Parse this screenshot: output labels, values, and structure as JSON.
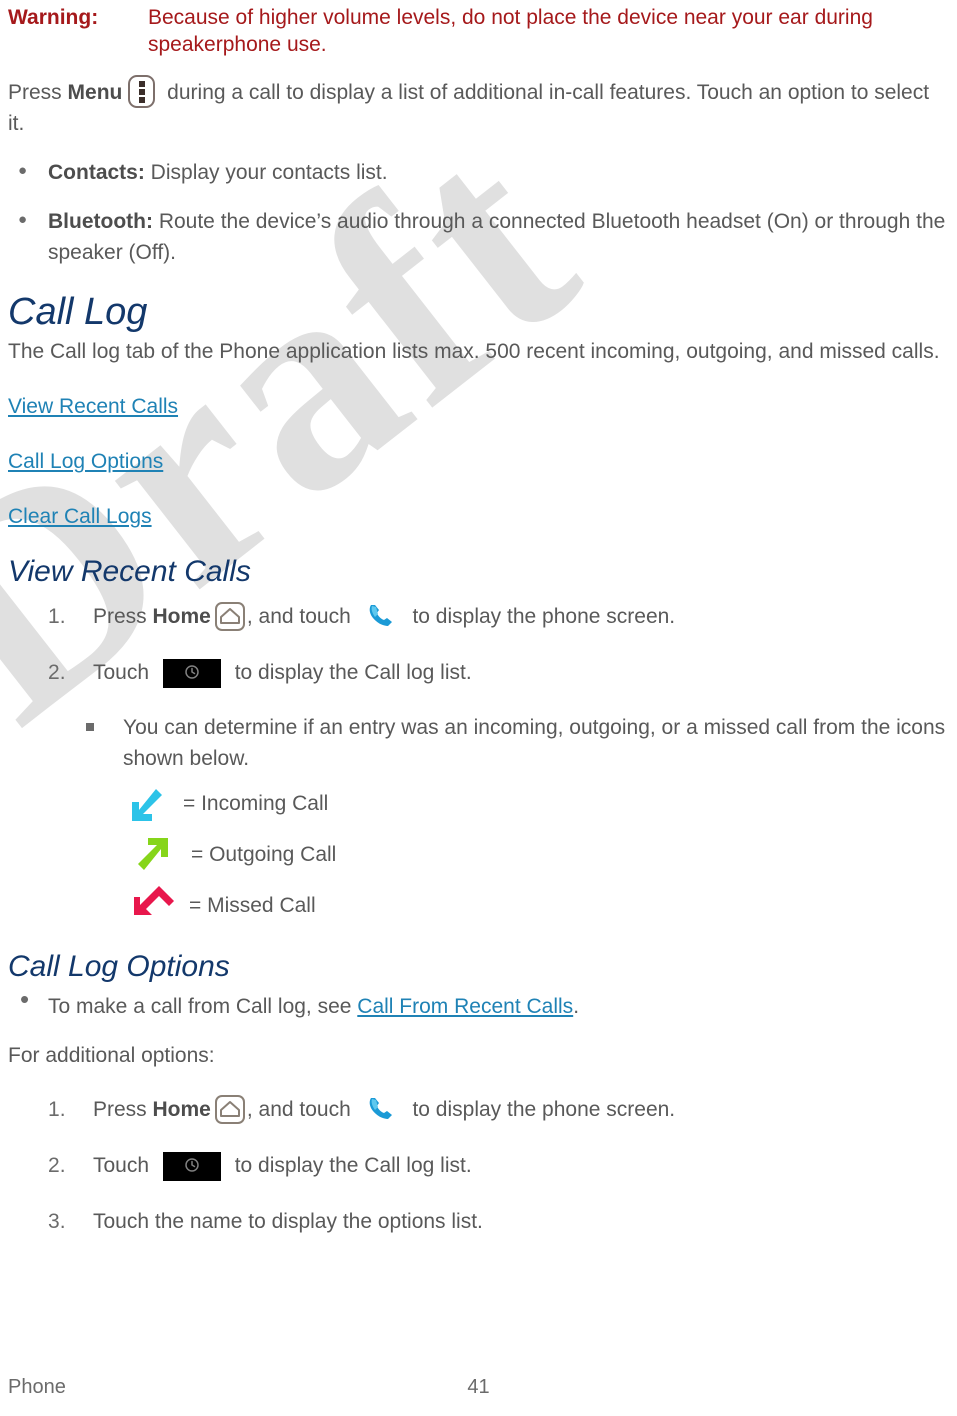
{
  "watermark": {
    "text": "Draft",
    "color": "#e0e0e0"
  },
  "warning": {
    "label": "Warning:",
    "text": "Because of higher volume levels, do not place the device near your ear during speakerphone use.",
    "color": "#A5191B"
  },
  "intro": {
    "before_menu": "Press ",
    "menu_label": "Menu",
    "after_menu": " during a call to display a list of additional in-call features. Touch an option to select it."
  },
  "menu_options": [
    {
      "term": "Contacts:",
      "desc": " Display your contacts list."
    },
    {
      "term": "Bluetooth:",
      "desc": " Route the device’s audio through a connected Bluetooth headset (On) or through the speaker (Off)."
    }
  ],
  "call_log": {
    "heading": "Call Log",
    "intro": "The Call log tab of the Phone application lists max. 500 recent incoming, outgoing, and missed calls.",
    "links": [
      "View Recent Calls",
      "Call Log Options",
      "Clear Call Logs"
    ]
  },
  "view_recent_calls": {
    "heading": "View Recent Calls",
    "step1_a": "Press ",
    "step1_home": "Home",
    "step1_b": ", and touch ",
    "step1_c": " to display the phone screen.",
    "step2_a": "Touch ",
    "step2_b": " to display the Call log list.",
    "note": "You can determine if an entry was an incoming, outgoing, or a missed call from the icons shown below.",
    "legend": [
      {
        "icon": "incoming-call-icon",
        "label": "= Incoming Call",
        "color": "#2CC3E8"
      },
      {
        "icon": "outgoing-call-icon",
        "label": "= Outgoing Call",
        "color": "#86D51A"
      },
      {
        "icon": "missed-call-icon",
        "label": "= Missed Call",
        "color": "#E8174C"
      }
    ]
  },
  "call_log_options": {
    "heading": "Call Log Options",
    "bullet_before_link": "To make a call from Call log, see ",
    "bullet_link": "Call From Recent Calls",
    "bullet_after_link": ".",
    "for_additional": "For additional options:",
    "step1_a": "Press ",
    "step1_home": "Home",
    "step1_b": ", and touch ",
    "step1_c": " to display the phone screen.",
    "step2_a": "Touch ",
    "step2_b": " to display the Call log list.",
    "step3": "Touch the name to display the options list."
  },
  "footer": {
    "section": "Phone",
    "page_number": "41"
  },
  "colors": {
    "heading": "#13386B",
    "link": "#1F82B5",
    "body": "#595959",
    "warning": "#A5191B"
  }
}
